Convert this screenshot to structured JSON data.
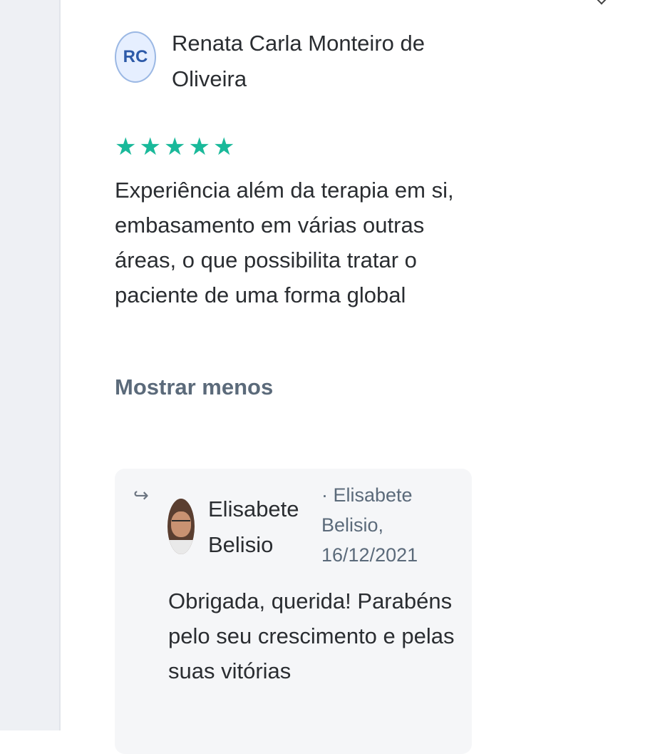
{
  "review": {
    "avatar_initials": "RC",
    "reviewer_name": "Renata Carla Monteiro de Oliveira",
    "rating_stars": 5,
    "text": "Experiência além da terapia em si, embasamento em várias outras áreas, o que possibilita tratar o paciente de uma forma global",
    "toggle_label": "Mostrar menos"
  },
  "reply": {
    "author": "Elisabete Belisio",
    "meta": "· Elisabete Belisio, 16/12/2021",
    "text": "Obrigada, querida! Parabéns pelo seu crescimento e pelas suas vitórias",
    "arrow_icon": "reply-arrow-icon"
  },
  "colors": {
    "star": "#1ab99a",
    "muted_text": "#5b6a7a",
    "avatar_text": "#2d5aa8"
  }
}
